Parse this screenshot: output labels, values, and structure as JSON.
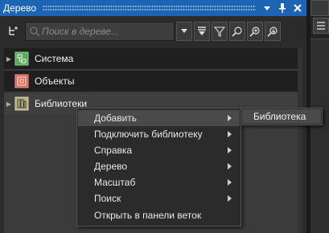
{
  "panel": {
    "title": "Дерево",
    "buttons": [
      "dropdown-icon",
      "pin-icon",
      "close-icon"
    ]
  },
  "toolbar": {
    "tree_icon": "tree-view-icon",
    "search_placeholder": "Поиск в дереве...",
    "buttons": [
      "dropdown-arrow-icon",
      "collapse-icon",
      "filter-icon",
      "find-icon",
      "find-next-icon",
      "find-previous-icon"
    ]
  },
  "tree": {
    "items": [
      {
        "label": "Система",
        "icon": "system-icon",
        "expandable": true
      },
      {
        "label": "Объекты",
        "icon": "objects-icon",
        "expandable": false
      },
      {
        "label": "Библиотеки",
        "icon": "libraries-icon",
        "expandable": true
      }
    ]
  },
  "context_menu": {
    "items": [
      {
        "label": "Добавить",
        "has_submenu": true
      },
      {
        "label": "Подключить библиотеку",
        "has_submenu": true
      },
      {
        "label": "Справка",
        "has_submenu": true
      },
      {
        "label": "Дерево",
        "has_submenu": true
      },
      {
        "label": "Масштаб",
        "has_submenu": true
      },
      {
        "label": "Поиск",
        "has_submenu": true
      },
      {
        "label": "Открыть в панели веток",
        "has_submenu": false
      }
    ]
  },
  "submenu": {
    "items": [
      {
        "label": "Библиотека"
      }
    ]
  },
  "colors": {
    "titlebar": "#1e64b4",
    "menu_highlight": "#4a4a4a",
    "system_icon": "#5fa85f",
    "objects_icon": "#d06a5a",
    "libraries_icon": "#b8b08a"
  }
}
